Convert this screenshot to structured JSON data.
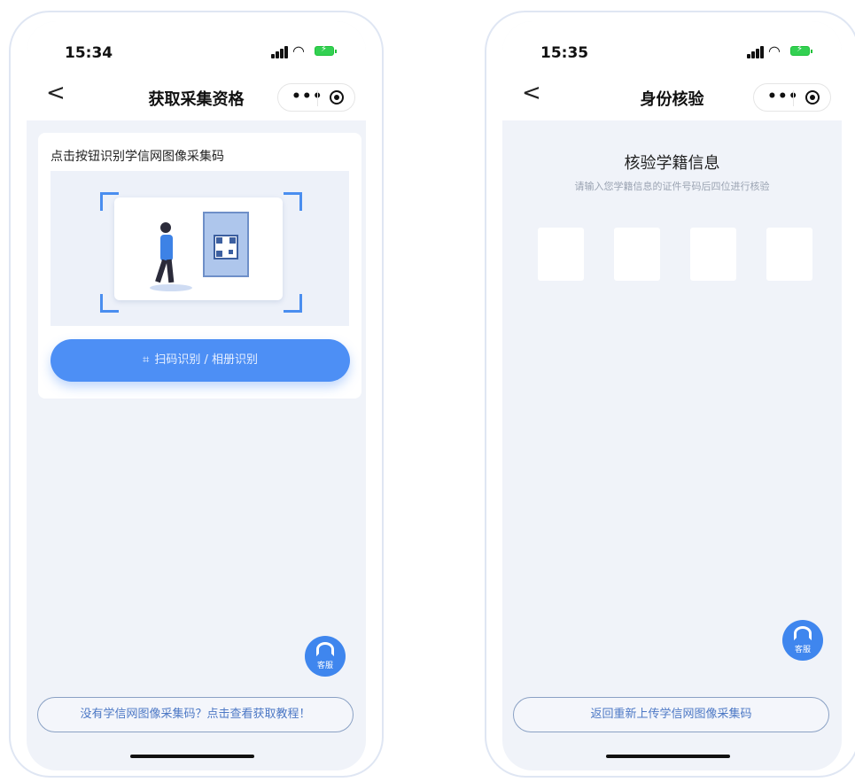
{
  "colors": {
    "accent": "#4d8ff5",
    "screen_bg": "#f0f3f9",
    "link": "#4c78c5"
  },
  "left": {
    "status": {
      "time": "15:34"
    },
    "nav": {
      "back": "<",
      "title": "获取采集资格"
    },
    "card": {
      "title": "点击按钮识别学信网图像采集码",
      "scan_button": "扫码识别 / 相册识别"
    },
    "service": {
      "label": "客服"
    },
    "bottom_link": "没有学信网图像采集码？点击查看获取教程！"
  },
  "right": {
    "status": {
      "time": "15:35"
    },
    "nav": {
      "back": "<",
      "title": "身份核验"
    },
    "verify": {
      "title": "核验学籍信息",
      "subtitle": "请输入您学籍信息的证件号码后四位进行核验",
      "code_boxes": [
        "",
        "",
        "",
        ""
      ]
    },
    "service": {
      "label": "客服"
    },
    "bottom_link": "返回重新上传学信网图像采集码"
  }
}
